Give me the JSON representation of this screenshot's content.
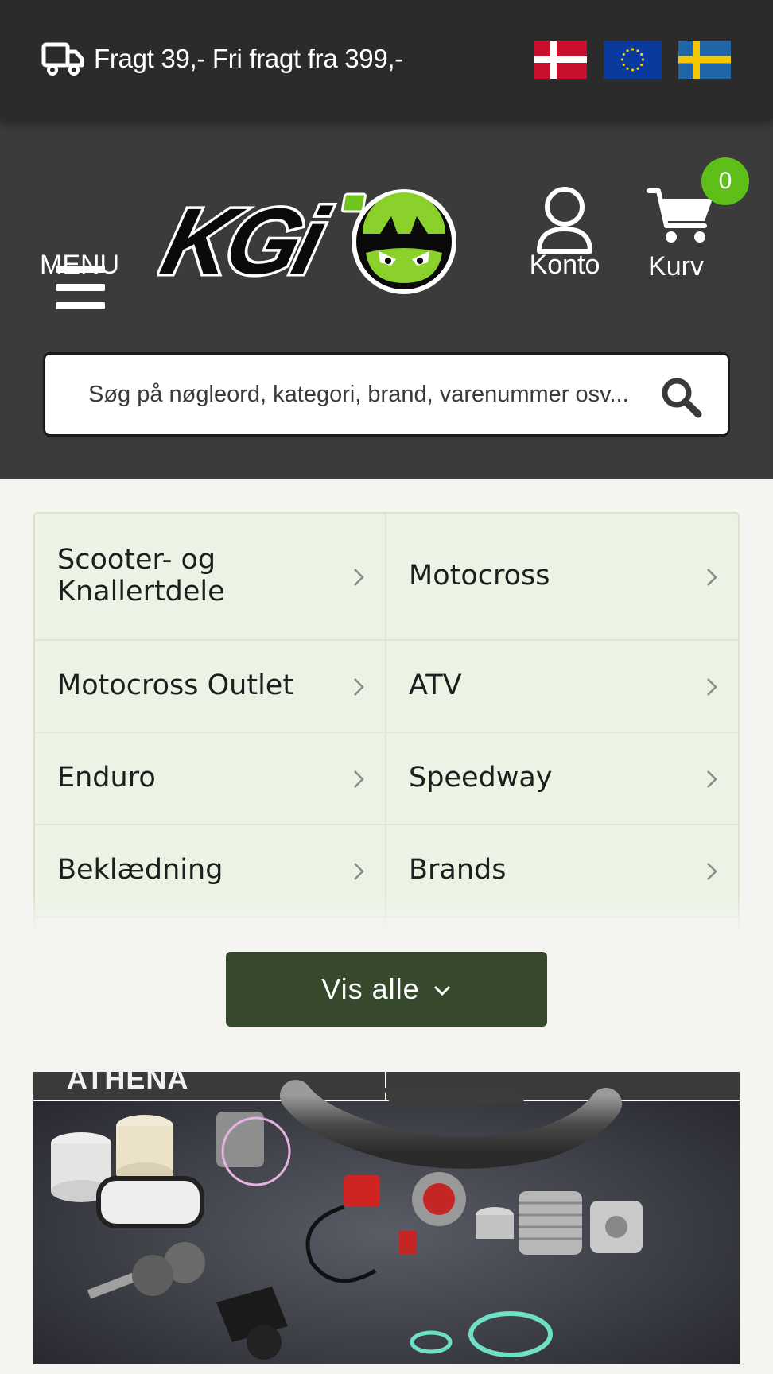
{
  "topbar": {
    "shipping_text": "Fragt 39,- Fri fragt fra 399,-",
    "truck_icon": "truck-icon",
    "flags": [
      {
        "name": "denmark-flag",
        "colors": [
          "#c8102e",
          "#ffffff"
        ]
      },
      {
        "name": "eu-flag",
        "colors": [
          "#003399",
          "#ffcc00"
        ]
      },
      {
        "name": "sweden-flag",
        "colors": [
          "#006aa7",
          "#fecc00"
        ]
      }
    ]
  },
  "header": {
    "menu_label": "MENU",
    "logo_text": "KGi",
    "account_label": "Konto",
    "cart_label": "Kurv",
    "cart_count": "0",
    "accent_color": "#5fbf19"
  },
  "search": {
    "placeholder": "Søg på nøgleord, kategori, brand, varenummer osv..."
  },
  "categories": [
    {
      "label_line1": "Scooter- og",
      "label_line2": "Knallertdele"
    },
    {
      "label": "Motocross"
    },
    {
      "label": "Motocross Outlet"
    },
    {
      "label": "ATV"
    },
    {
      "label": "Enduro"
    },
    {
      "label": "Speedway"
    },
    {
      "label": "Beklædning"
    },
    {
      "label": "Brands"
    }
  ],
  "show_all": {
    "label": "Vis alle",
    "button_color": "#36492c"
  },
  "banner": {
    "brand_text": "ATHENA"
  }
}
